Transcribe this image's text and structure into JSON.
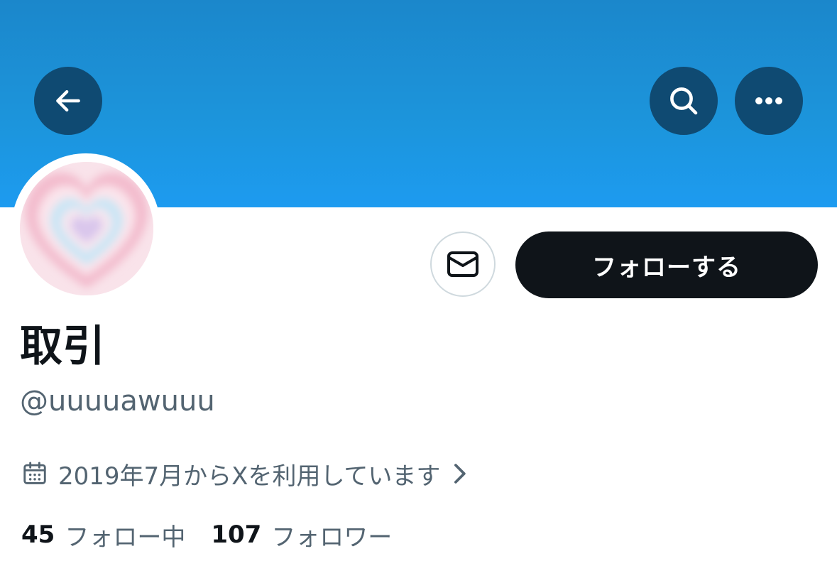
{
  "header": {
    "back_icon": "arrow-left-icon",
    "search_icon": "search-icon",
    "more_icon": "more-horizontal-icon",
    "banner_color": "#1d9bf0"
  },
  "profile": {
    "display_name": "取引",
    "handle": "@uuuuawuuu",
    "avatar": "pastel-heart-gradient"
  },
  "actions": {
    "message_icon": "mail-icon",
    "follow_label": "フォローする"
  },
  "joined": {
    "text": "2019年7月からXを利用しています",
    "icon": "calendar-icon"
  },
  "stats": {
    "following_count": "45",
    "following_label": "フォロー中",
    "followers_count": "107",
    "followers_label": "フォロワー"
  }
}
